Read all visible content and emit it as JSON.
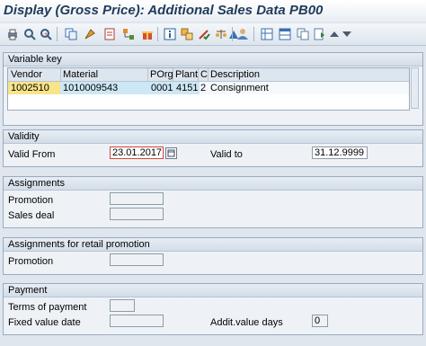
{
  "window": {
    "title": "Display (Gross Price): Additional Sales Data PB00"
  },
  "toolbar": {
    "icons": [
      "print-icon",
      "find-icon",
      "find-next-icon",
      "copy-icon",
      "execute-icon",
      "document-icon",
      "tree-icon",
      "gift-icon",
      "info-icon",
      "nested-icon",
      "pencil-check-icon",
      "scale-icon",
      "triangle-icon",
      "person-icon",
      "grid-icon",
      "table-icon",
      "copy-rows-icon",
      "insert-icon",
      "arrow-up-icon",
      "arrow-down-icon"
    ]
  },
  "variable_key": {
    "title": "Variable key",
    "columns": [
      "Vendor",
      "Material",
      "POrg",
      "Plant",
      "C",
      "Description"
    ],
    "row": {
      "vendor": "1002510",
      "material": "1010009543",
      "porg": "0001",
      "plant": "4151",
      "c": "2",
      "description": "Consignment"
    }
  },
  "validity": {
    "title": "Validity",
    "valid_from_label": "Valid From",
    "valid_from": "23.01.2017",
    "valid_to_label": "Valid to",
    "valid_to": "31.12.9999"
  },
  "assignments": {
    "title": "Assignments",
    "promotion_label": "Promotion",
    "promotion_value": "",
    "sales_deal_label": "Sales deal",
    "sales_deal_value": ""
  },
  "retail_promotion": {
    "title": "Assignments for retail promotion",
    "promotion_label": "Promotion",
    "promotion_value": ""
  },
  "payment": {
    "title": "Payment",
    "terms_label": "Terms of payment",
    "terms_value": "",
    "fixed_date_label": "Fixed value date",
    "fixed_date_value": "",
    "addit_days_label": "Addit.value days",
    "addit_days_value": "0"
  }
}
